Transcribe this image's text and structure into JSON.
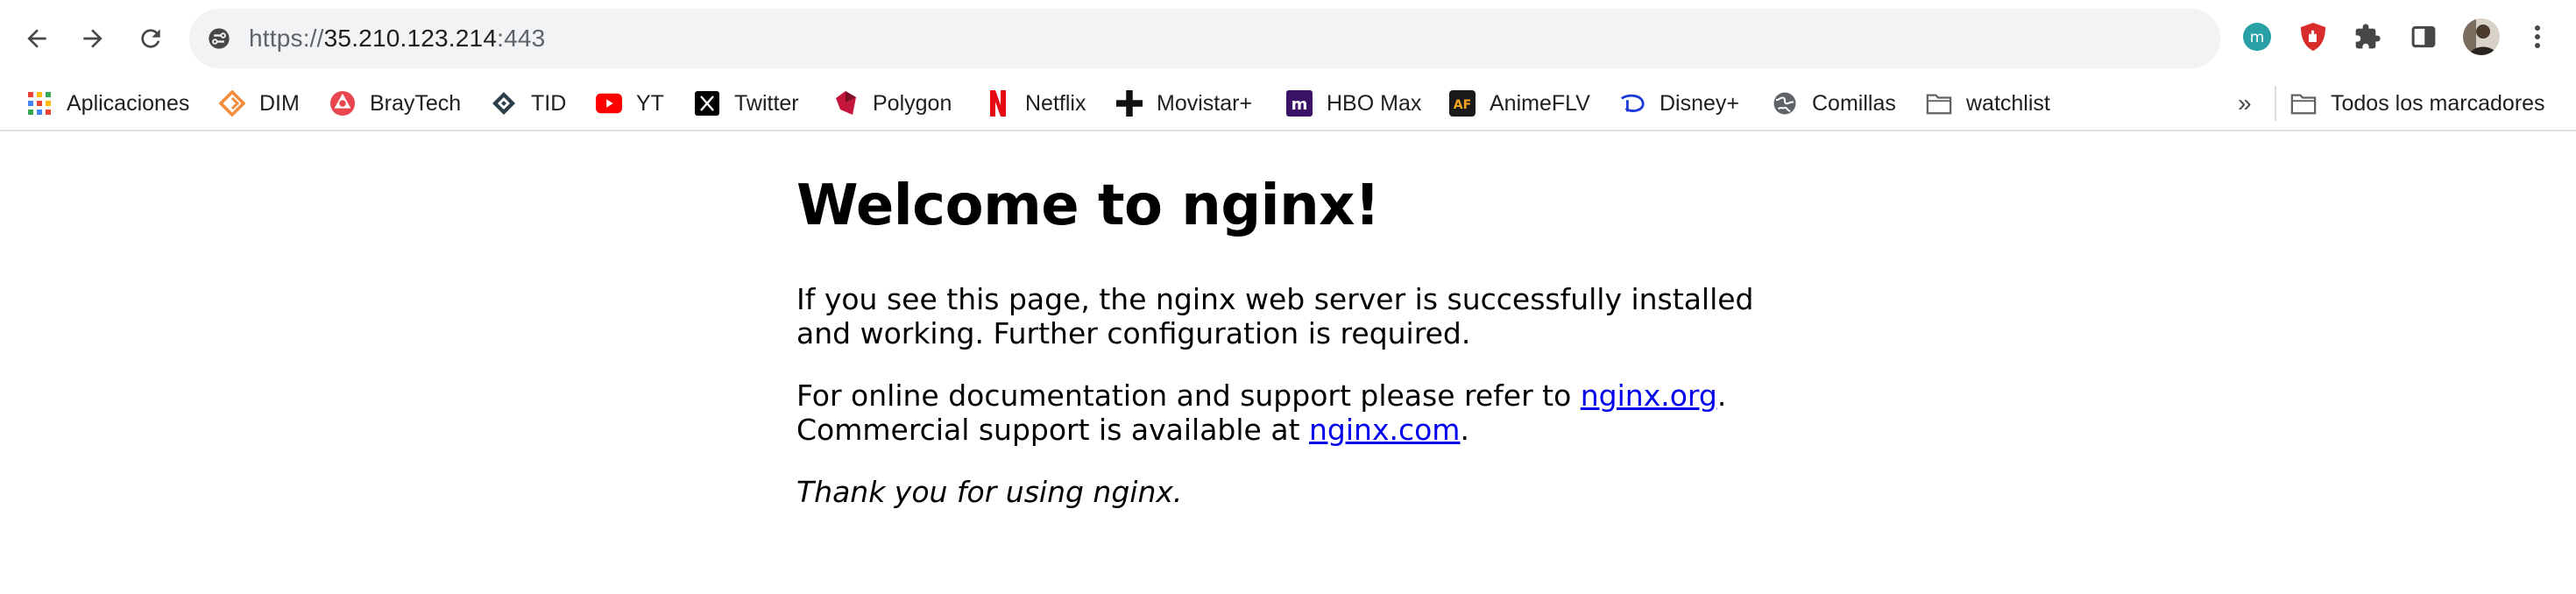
{
  "browser": {
    "url": {
      "scheme": "https://",
      "host": "35.210.123.214",
      "port": ":443"
    },
    "extensions": [
      "meet-extension-icon",
      "ublock-icon",
      "puzzle-icon",
      "side-panel-icon",
      "profile-avatar",
      "menu-kebab-icon"
    ]
  },
  "bookmarks": {
    "items": [
      {
        "label": "Aplicaciones",
        "icon": "apps-grid-icon"
      },
      {
        "label": "DIM",
        "icon": "dim-icon"
      },
      {
        "label": "BrayTech",
        "icon": "braytech-icon"
      },
      {
        "label": "TID",
        "icon": "tid-icon"
      },
      {
        "label": "YT",
        "icon": "youtube-icon"
      },
      {
        "label": "Twitter",
        "icon": "x-icon"
      },
      {
        "label": "Polygon",
        "icon": "polygon-icon"
      },
      {
        "label": "Netflix",
        "icon": "netflix-icon"
      },
      {
        "label": "Movistar+",
        "icon": "movistar-icon"
      },
      {
        "label": "HBO Max",
        "icon": "hbomax-icon"
      },
      {
        "label": "AnimeFLV",
        "icon": "animeflv-icon"
      },
      {
        "label": "Disney+",
        "icon": "disney-icon"
      },
      {
        "label": "Comillas",
        "icon": "globe-icon"
      },
      {
        "label": "watchlist",
        "icon": "folder-icon"
      }
    ],
    "more": "»",
    "all_bookmarks": "Todos los marcadores"
  },
  "page": {
    "title": "Welcome to nginx!",
    "p1": "If you see this page, the nginx web server is successfully installed and working. Further configuration is required.",
    "p2_prefix": "For online documentation and support please refer to ",
    "p2_link": "nginx.org",
    "p2_mid": ".",
    "p2_line2_prefix": "Commercial support is available at ",
    "p2_link2": "nginx.com",
    "p2_suffix": ".",
    "p3": "Thank you for using nginx."
  },
  "colors": {
    "link": "#0000ee",
    "omnibox_bg": "#f1f3f4"
  }
}
